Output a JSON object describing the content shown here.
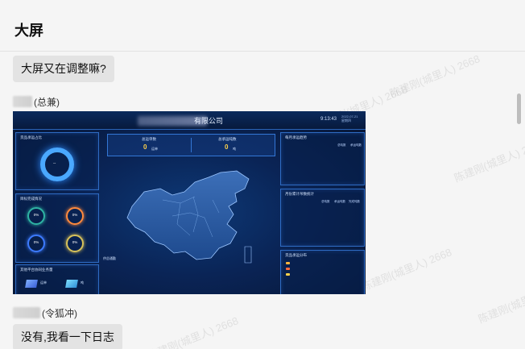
{
  "header": {
    "title": "大屏"
  },
  "messages": [
    {
      "type": "text",
      "text": "大屏又在调整嘛?"
    },
    {
      "type": "sender",
      "suffix": "(总兼)"
    },
    {
      "type": "image"
    },
    {
      "type": "sender",
      "suffix": "(令狐冲)"
    },
    {
      "type": "text",
      "text": "没有,我看一下日志"
    }
  ],
  "watermark": "陈建刚(城里人) 2668",
  "dashboard": {
    "title_suffix": "有限公司",
    "time": "9:13:43",
    "date": "2022-07-21",
    "weekday": "星期四",
    "left_panels": [
      {
        "title": "货品承运占比"
      },
      {
        "title": "目标完成情况"
      },
      {
        "title": "其他平台协同业务量"
      }
    ],
    "right_panels": [
      {
        "title": "每月承运趋势"
      },
      {
        "title": "月份累计吊数统计"
      },
      {
        "title": "货品承运分布"
      }
    ],
    "stats": [
      {
        "label": "总运单数",
        "value": "0",
        "unit": "运单"
      },
      {
        "label": "总承运吨数",
        "value": "0",
        "unit": "吨"
      }
    ],
    "rings": [
      "0%",
      "0%",
      "0%",
      "0%"
    ],
    "donut_center": "--",
    "map_label": "供总通勤",
    "legend": [
      "总吨数",
      "承运吨数"
    ],
    "legend2": [
      "总吨数",
      "承运吨数",
      "完成吨数"
    ],
    "mini_labels": [
      "运单",
      "吨"
    ],
    "colors": {
      "accent": "#4aa8ff",
      "value": "#ffd24a",
      "ring1": "#2fb4a4",
      "ring2": "#ff8a3d",
      "ring3": "#3d7bff",
      "ring4": "#d8c25a"
    }
  }
}
